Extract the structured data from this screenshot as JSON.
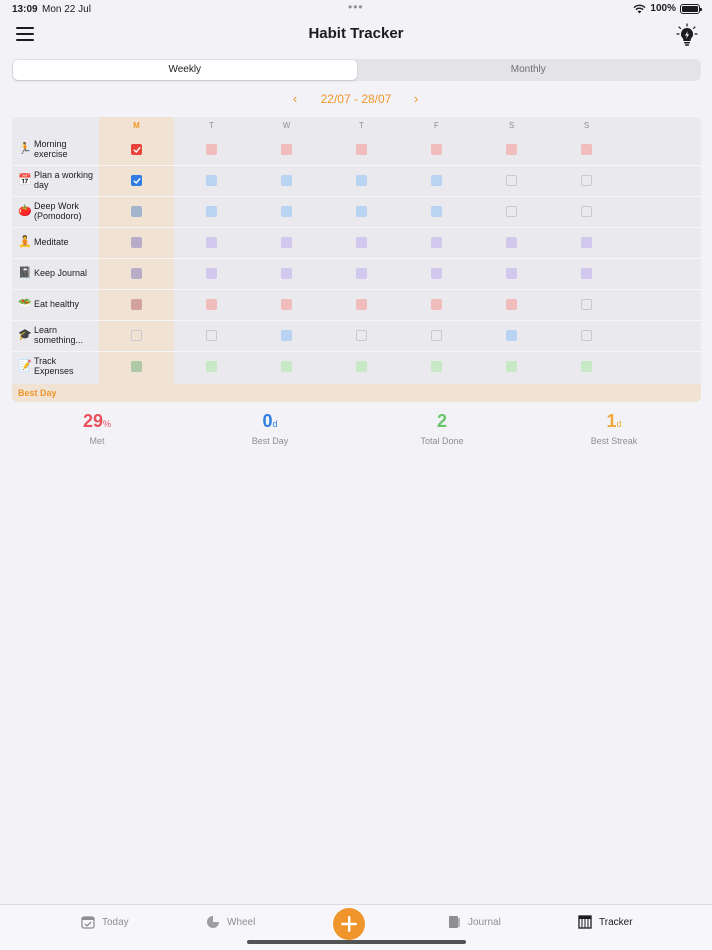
{
  "status": {
    "time": "13:09",
    "date": "Mon 22 Jul",
    "battery": "100%",
    "dots": "•••"
  },
  "nav": {
    "title": "Habit Tracker"
  },
  "segments": {
    "weekly": "Weekly",
    "monthly": "Monthly",
    "selected": "Weekly"
  },
  "date_range": {
    "label": "22/07 - 28/07",
    "prev": "‹",
    "next": "›"
  },
  "days": [
    "M",
    "T",
    "W",
    "T",
    "F",
    "S",
    "S"
  ],
  "today_index": 0,
  "habits": [
    {
      "name": "Morning exercise",
      "icon": "runner-icon",
      "glyph": "🏃",
      "color": "#f0bcbc",
      "states": [
        "checked",
        "filled",
        "filled",
        "filled",
        "filled",
        "filled",
        "filled"
      ],
      "check_color": "#e8433a"
    },
    {
      "name": "Plan a working day",
      "icon": "calendar-icon",
      "glyph": "📅",
      "color": "#b9d3f3",
      "states": [
        "checked",
        "filled",
        "filled",
        "filled",
        "filled",
        "empty",
        "empty"
      ],
      "check_color": "#2f7de1"
    },
    {
      "name": "Deep Work (Pomodoro)",
      "icon": "tomato-icon",
      "glyph": "🍅",
      "color": "#b9d3f3",
      "states": [
        "filled",
        "filled",
        "filled",
        "filled",
        "filled",
        "empty",
        "empty"
      ],
      "check_color": "#2f7de1"
    },
    {
      "name": "Meditate",
      "icon": "meditation-icon",
      "glyph": "🧘",
      "color": "#d2c8ee",
      "states": [
        "filled",
        "filled",
        "filled",
        "filled",
        "filled",
        "filled",
        "filled"
      ],
      "check_color": "#8e6fd8"
    },
    {
      "name": "Keep Journal",
      "icon": "notebook-icon",
      "glyph": "📓",
      "color": "#d2c8ee",
      "states": [
        "filled",
        "filled",
        "filled",
        "filled",
        "filled",
        "filled",
        "filled"
      ],
      "check_color": "#8e6fd8"
    },
    {
      "name": "Eat healthy",
      "icon": "salad-icon",
      "glyph": "🥗",
      "color": "#f0bcbc",
      "states": [
        "filled",
        "filled",
        "filled",
        "filled",
        "filled",
        "filled",
        "empty"
      ],
      "check_color": "#e8433a"
    },
    {
      "name": "Learn something...",
      "icon": "graduation-cap-icon",
      "glyph": "🎓",
      "color": "#b9d3f3",
      "states": [
        "empty",
        "empty",
        "filled",
        "empty",
        "empty",
        "filled",
        "empty"
      ],
      "check_color": "#2f7de1"
    },
    {
      "name": "Track Expenses",
      "icon": "memo-icon",
      "glyph": "📝",
      "color": "#c7e9c6",
      "states": [
        "filled",
        "filled",
        "filled",
        "filled",
        "filled",
        "filled",
        "filled"
      ],
      "check_color": "#4cb84a"
    }
  ],
  "best_day_label": "Best Day",
  "stats": [
    {
      "value": "29",
      "unit": "%",
      "label": "Met",
      "color": "#e8505b"
    },
    {
      "value": "0",
      "unit": "d",
      "label": "Best Day",
      "color": "#2f7de1"
    },
    {
      "value": "2",
      "unit": "",
      "label": "Total Done",
      "color": "#6cc46a"
    },
    {
      "value": "1",
      "unit": "d",
      "label": "Best Streak",
      "color": "#f0a83a"
    }
  ],
  "tabs": [
    {
      "label": "Today",
      "icon": "calendar-check-icon",
      "active": false
    },
    {
      "label": "Wheel",
      "icon": "pie-chart-icon",
      "active": false
    },
    {
      "label": "Journal",
      "icon": "journal-icon",
      "active": false
    },
    {
      "label": "Tracker",
      "icon": "grid-table-icon",
      "active": true
    }
  ],
  "colors": {
    "accent": "#f0952b",
    "today_column": "#f1e3d3"
  }
}
